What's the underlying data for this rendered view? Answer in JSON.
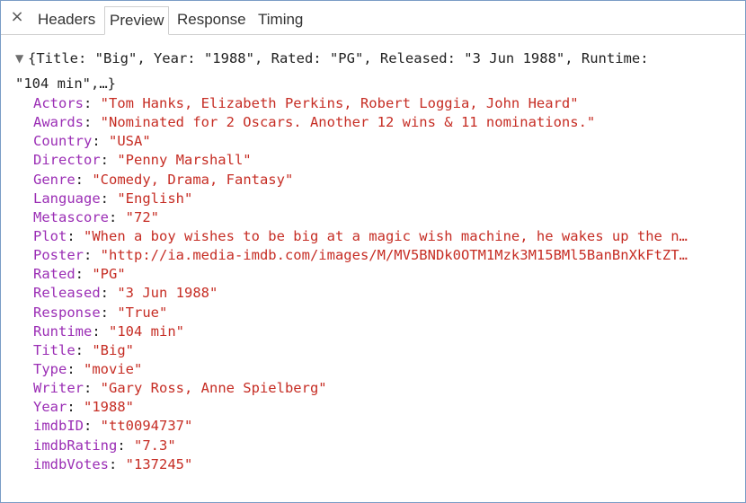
{
  "tabs": {
    "close_icon": "×",
    "headers": "Headers",
    "preview": "Preview",
    "response": "Response",
    "timing": "Timing"
  },
  "summary": {
    "toggle_icon": "▼",
    "line1": "{Title: \"Big\", Year: \"1988\", Rated: \"PG\", Released: \"3 Jun 1988\", Runtime:",
    "line2": "\"104 min\",…}"
  },
  "properties": [
    {
      "key": "Actors",
      "value": "\"Tom Hanks, Elizabeth Perkins, Robert Loggia, John Heard\""
    },
    {
      "key": "Awards",
      "value": "\"Nominated for 2 Oscars. Another 12 wins & 11 nominations.\""
    },
    {
      "key": "Country",
      "value": "\"USA\""
    },
    {
      "key": "Director",
      "value": "\"Penny Marshall\""
    },
    {
      "key": "Genre",
      "value": "\"Comedy, Drama, Fantasy\""
    },
    {
      "key": "Language",
      "value": "\"English\""
    },
    {
      "key": "Metascore",
      "value": "\"72\""
    },
    {
      "key": "Plot",
      "value": "\"When a boy wishes to be big at a magic wish machine, he wakes up the n…"
    },
    {
      "key": "Poster",
      "value": "\"http://ia.media-imdb.com/images/M/MV5BNDk0OTM1Mzk3M15BMl5BanBnXkFtZT…"
    },
    {
      "key": "Rated",
      "value": "\"PG\""
    },
    {
      "key": "Released",
      "value": "\"3 Jun 1988\""
    },
    {
      "key": "Response",
      "value": "\"True\""
    },
    {
      "key": "Runtime",
      "value": "\"104 min\""
    },
    {
      "key": "Title",
      "value": "\"Big\""
    },
    {
      "key": "Type",
      "value": "\"movie\""
    },
    {
      "key": "Writer",
      "value": "\"Gary Ross, Anne Spielberg\""
    },
    {
      "key": "Year",
      "value": "\"1988\""
    },
    {
      "key": "imdbID",
      "value": "\"tt0094737\""
    },
    {
      "key": "imdbRating",
      "value": "\"7.3\""
    },
    {
      "key": "imdbVotes",
      "value": "\"137245\""
    }
  ],
  "colors": {
    "key": "#9b2eb5",
    "string_value": "#c62d24",
    "frame_border": "#7a9cc6"
  }
}
